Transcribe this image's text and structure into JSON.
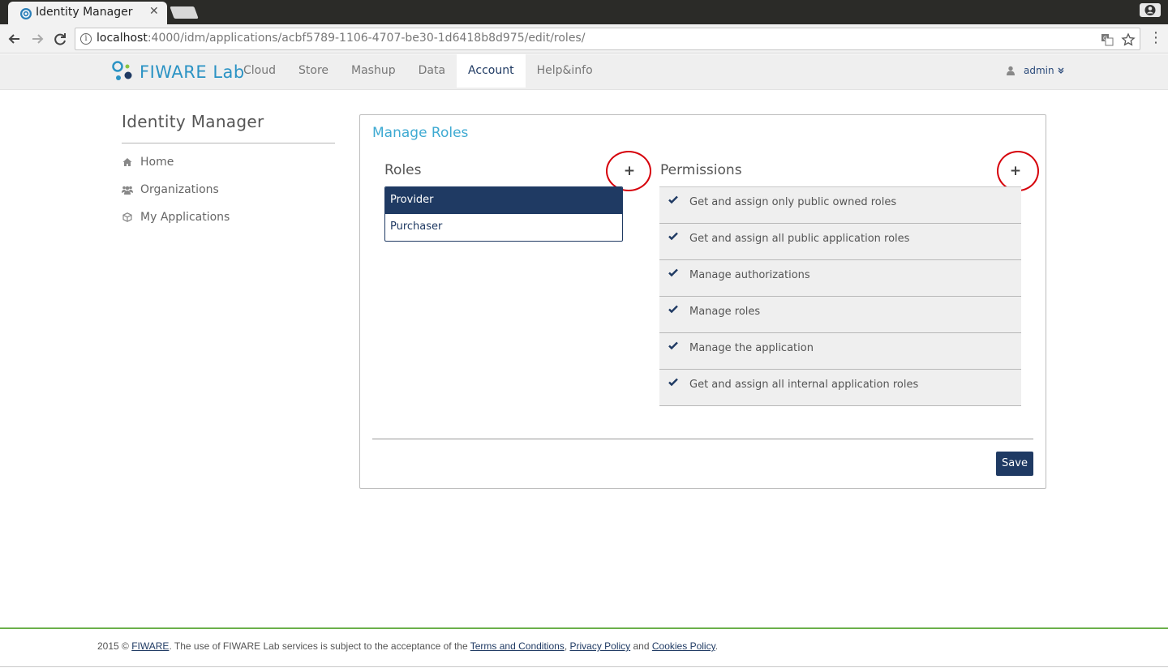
{
  "browser": {
    "tab_title": "Identity Manager",
    "tab_close": "✕",
    "url_host": "localhost",
    "url_path": ":4000/idm/applications/acbf5789-1106-4707-be30-1d6418b8d975/edit/roles/"
  },
  "header": {
    "logo_fi": "FIWARE",
    "logo_lab": "Lab",
    "nav": [
      "Cloud",
      "Store",
      "Mashup",
      "Data",
      "Account",
      "Help&info"
    ],
    "active_nav": "Account",
    "user": "admin"
  },
  "sidebar": {
    "title": "Identity Manager",
    "items": [
      {
        "label": "Home",
        "icon": "home-icon"
      },
      {
        "label": "Organizations",
        "icon": "users-icon"
      },
      {
        "label": "My Applications",
        "icon": "cube-icon"
      }
    ]
  },
  "panel": {
    "title": "Manage Roles",
    "roles_heading": "Roles",
    "permissions_heading": "Permissions",
    "add_symbol": "+",
    "roles": [
      {
        "label": "Provider",
        "selected": true
      },
      {
        "label": "Purchaser",
        "selected": false
      }
    ],
    "permissions": [
      "Get and assign only public owned roles",
      "Get and assign all public application roles",
      "Manage authorizations",
      "Manage roles",
      "Manage the application",
      "Get and assign all internal application roles"
    ],
    "save_label": "Save"
  },
  "footer": {
    "prefix": "2015 © ",
    "fiware_link": "FIWARE",
    "middle": ". The use of FIWARE Lab services is subject to the acceptance of the ",
    "terms_link": "Terms and Conditions",
    "comma": ", ",
    "privacy_link": "Privacy Policy",
    "and": " and ",
    "cookies_link": "Cookies Policy",
    "suffix": "."
  },
  "colors": {
    "brand_navy": "#1f3a63",
    "accent_teal": "#3eaad2",
    "annotation_red": "#d6000a",
    "footer_green": "#6bb04a"
  }
}
